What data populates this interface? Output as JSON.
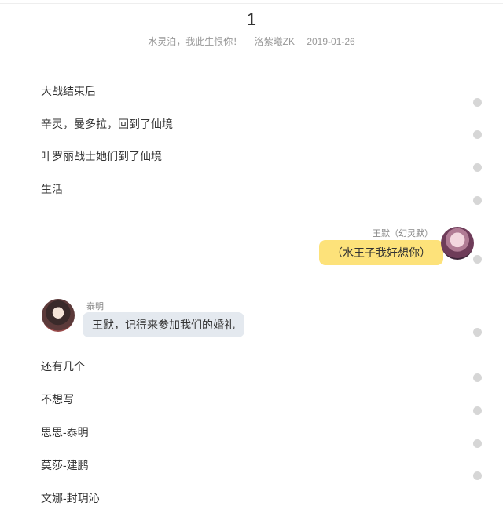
{
  "chapter": {
    "number": "1",
    "title": "水灵泊，我此生恨你！",
    "author": "洛紫曦ZK",
    "date": "2019-01-26"
  },
  "paragraphs_top": [
    "大战结束后",
    "辛灵，曼多拉，回到了仙境",
    "叶罗丽战士她们到了仙境",
    "生活"
  ],
  "dialog_right": {
    "speaker": "王默（幻灵默）",
    "text": "（水王子我好想你）"
  },
  "dialog_left": {
    "speaker": "泰明",
    "text": "王默，记得来参加我们的婚礼"
  },
  "paragraphs_bottom": [
    "还有几个",
    "不想写",
    "思思-泰明",
    "莫莎-建鹏",
    "文娜-封玥沁"
  ],
  "icons": {
    "comment_dot": "comment-dot-icon",
    "avatar_right": "wangmo-avatar",
    "avatar_left": "taiming-avatar"
  },
  "colors": {
    "bubble_right": "#fde27a",
    "bubble_left": "#e4e9ef",
    "dot": "#d6d6d6"
  }
}
